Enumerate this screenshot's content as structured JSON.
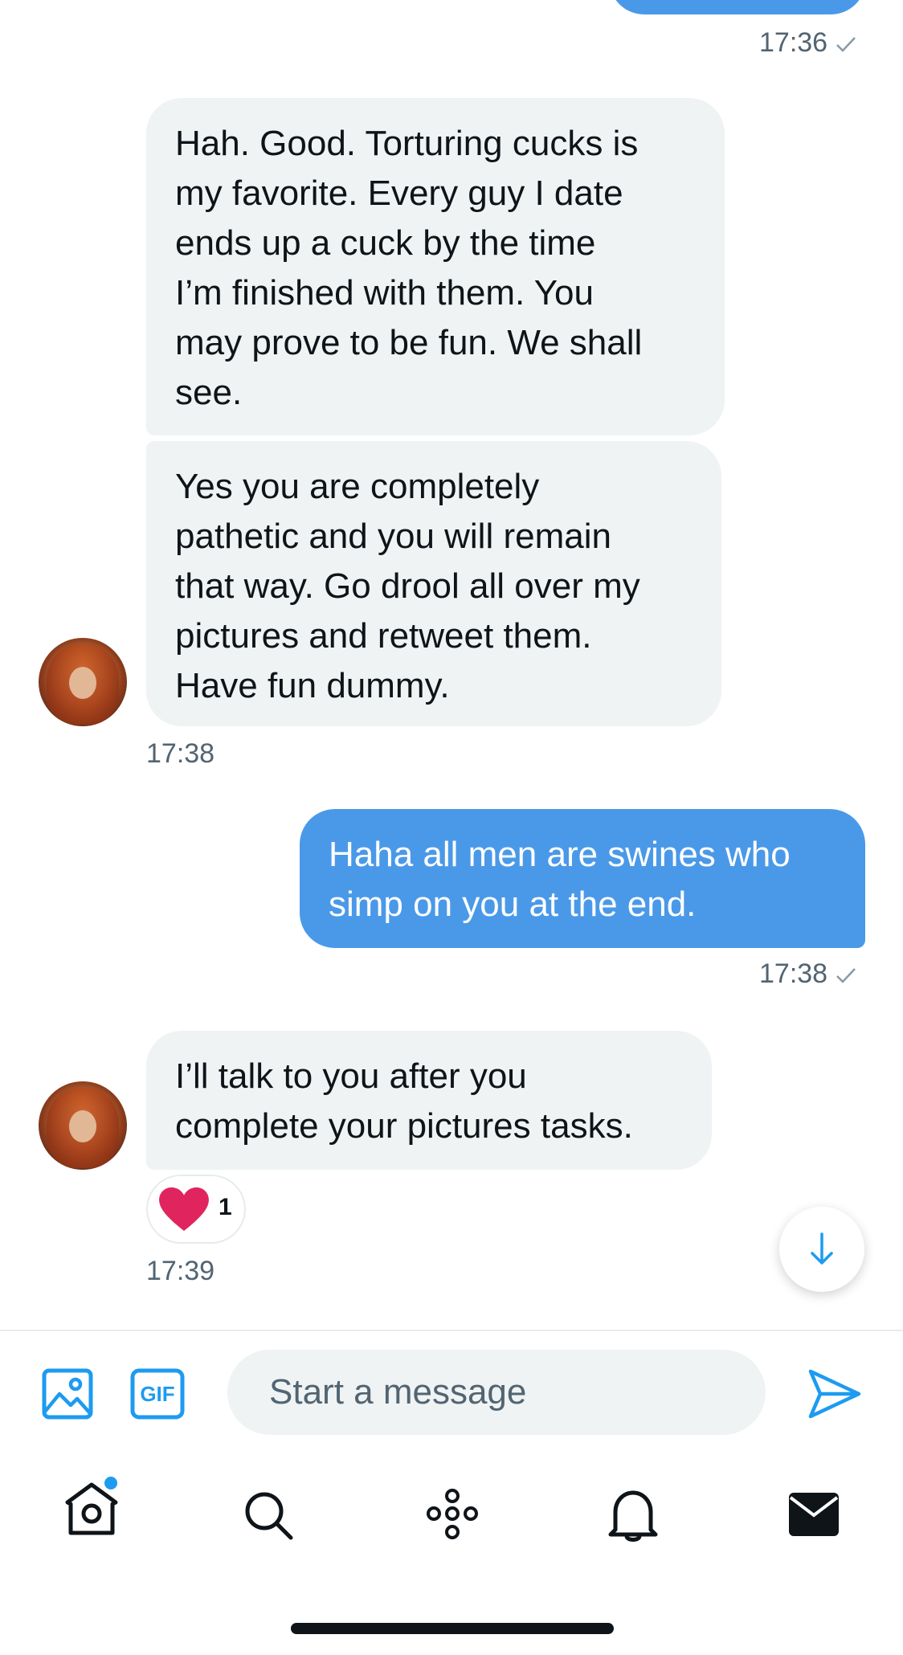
{
  "conversation": {
    "top_timestamp": "17:36",
    "messages": [
      {
        "text": "Hah. Good. Torturing cucks is\nmy favorite. Every guy I date\nends up a cuck by the time\nI’m finished with them. You\nmay prove to be fun. We shall\nsee."
      },
      {
        "text": "Yes you are completely\npathetic and you will remain\nthat way. Go drool all over my\npictures and retweet them.\nHave fun dummy."
      },
      {
        "timestamp": "17:38"
      },
      {
        "text": "Haha all men are swines who\nsimp on you at the end.",
        "timestamp": "17:38"
      },
      {
        "text": "I’ll talk to you after you\ncomplete your pictures tasks.",
        "reaction_count": "1",
        "timestamp": "17:39"
      }
    ]
  },
  "composer": {
    "placeholder": "Start a message",
    "gif_label": "GIF"
  },
  "nav": {
    "items": [
      "home-icon",
      "search-icon",
      "spaces-icon",
      "notifications-icon",
      "messages-icon"
    ]
  },
  "colors": {
    "accent": "#1d9bf0",
    "outgoing_bubble": "#4a99e9",
    "incoming_bubble": "#eff3f4",
    "reaction_heart": "#e0245e"
  }
}
